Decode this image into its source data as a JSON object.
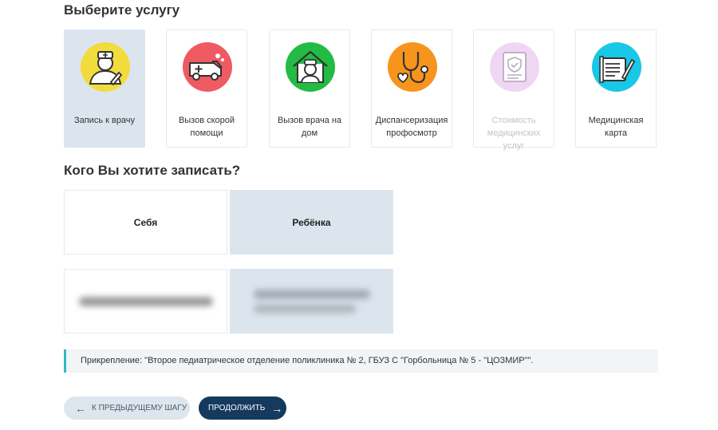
{
  "headings": {
    "choose_service": "Выберите услугу",
    "who": "Кого Вы хотите записать?"
  },
  "services": [
    {
      "label": "Запись к врачу",
      "icon": "doctor-appointment-icon",
      "color": "#f2dc3d",
      "state": "selected"
    },
    {
      "label": "Вызов скорой помощи",
      "icon": "ambulance-icon",
      "color": "#ef5a63",
      "state": "normal"
    },
    {
      "label": "Вызов врача на дом",
      "icon": "home-doctor-icon",
      "color": "#22bb44",
      "state": "normal"
    },
    {
      "label": "Диспансеризация профосмотр",
      "icon": "stethoscope-icon",
      "color": "#f7941d",
      "state": "normal"
    },
    {
      "label": "Стоимость медицинских услуг",
      "icon": "price-document-icon",
      "color": "#e9c6f0",
      "state": "disabled"
    },
    {
      "label": "Медицинская карта",
      "icon": "medical-card-icon",
      "color": "#19c7e6",
      "state": "normal"
    }
  ],
  "who_options": [
    {
      "label": "Себя",
      "state": "normal"
    },
    {
      "label": "Ребёнка",
      "state": "selected"
    }
  ],
  "notice": {
    "text": "Прикрепление: \"Второе педиатрическое отделение поликлиника № 2, ГБУЗ С \"Горбольница № 5 - \"ЦОЗМИР\"\"."
  },
  "buttons": {
    "back": "К ПРЕДЫДУЩЕМУ ШАГУ",
    "next": "ПРОДОЛЖИТЬ"
  }
}
